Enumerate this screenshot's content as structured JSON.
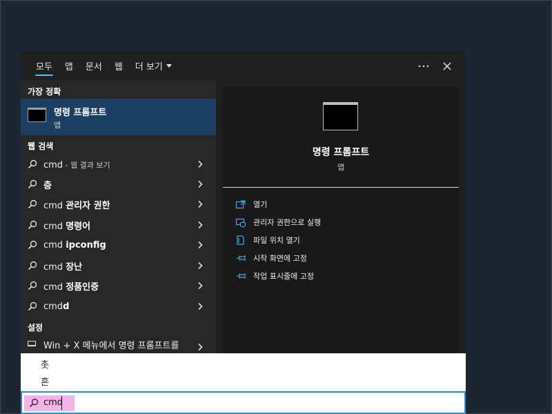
{
  "tabs": [
    {
      "label": "모두",
      "active": true
    },
    {
      "label": "앱",
      "active": false
    },
    {
      "label": "문서",
      "active": false
    },
    {
      "label": "웹",
      "active": false
    },
    {
      "label": "더 보기",
      "active": false
    }
  ],
  "header": {
    "more_icon": "ellipsis-icon",
    "close_icon": "close-icon"
  },
  "best_match": {
    "section_label": "가장 정확",
    "name": "명령 프롬프트",
    "type": "앱"
  },
  "web_search": {
    "section_label": "웹 검색",
    "items": [
      {
        "query": "cmd",
        "suffix": " - 웹 결과 보기"
      },
      {
        "query": "",
        "bold": "층"
      },
      {
        "query": "cmd ",
        "bold": "관리자 권한"
      },
      {
        "query": "cmd ",
        "bold": "명령어"
      },
      {
        "query": "cmd ",
        "bold": "ipconfig"
      },
      {
        "query": "cmd ",
        "bold": "장난"
      },
      {
        "query": "cmd ",
        "bold": "정품인증"
      },
      {
        "query": "cmd",
        "bold": "d"
      }
    ]
  },
  "settings": {
    "section_label": "설정",
    "item": "Win + X 메뉴에서 명령 프롬프트를"
  },
  "preview": {
    "title": "명령 프롬프트",
    "type": "앱",
    "actions": [
      {
        "label": "열기",
        "icon": "open-icon"
      },
      {
        "label": "관리자 권한으로 실행",
        "icon": "shield-icon"
      },
      {
        "label": "파일 위치 열기",
        "icon": "file-location-icon"
      },
      {
        "label": "시작 화면에 고정",
        "icon": "pin-icon"
      },
      {
        "label": "작업 표시줄에 고정",
        "icon": "pin-icon"
      }
    ]
  },
  "ime_candidates": [
    "촛",
    "흔"
  ],
  "search": {
    "value": "cmd"
  },
  "colors": {
    "accent": "#4cc2ff",
    "selected_row": "#1d4062",
    "search_highlight": "#f0b4e8",
    "search_border": "#1f8fd6"
  }
}
